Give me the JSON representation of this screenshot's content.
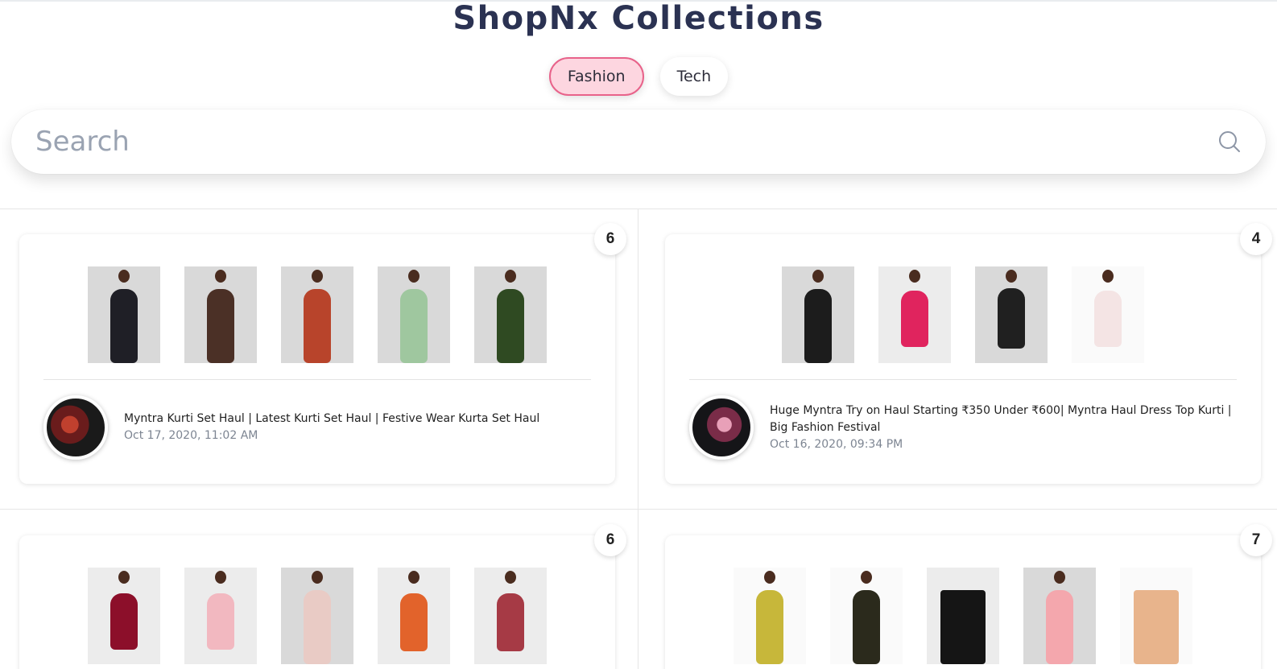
{
  "header": {
    "brand_a": "ShopNx",
    "brand_b": "Collections"
  },
  "tabs": [
    {
      "label": "Fashion",
      "active": true
    },
    {
      "label": "Tech",
      "active": false
    }
  ],
  "search": {
    "placeholder": "Search",
    "value": ""
  },
  "colors": {
    "accent": "#e8628a",
    "accent_bg": "#fdd6e0",
    "title": "#2b3252"
  },
  "collections": [
    {
      "count": "6",
      "title": "Myntra Kurti Set Haul | Latest Kurti Set Haul | Festive Wear Kurta Set Haul",
      "date": "Oct 17, 2020, 11:02 AM",
      "products": [
        "black kurta set",
        "brown kurta set",
        "rust kurta set",
        "mint kurta set",
        "olive kurta set"
      ]
    },
    {
      "count": "4",
      "title": "Huge Myntra Try on Haul Starting ₹350 Under ₹600| Myntra Haul Dress Top Kurti | Big Fashion Festival",
      "date": "Oct 16, 2020, 09:34 PM",
      "products": [
        "black floral maxi dress",
        "pink ruffle dress",
        "black floral dress",
        "white floral dress"
      ]
    },
    {
      "count": "6",
      "products": [
        "maroon dress",
        "pink lace dress",
        "floral wrap dress",
        "orange floral dress",
        "checked dress"
      ]
    },
    {
      "count": "7",
      "products": [
        "yellow kurta",
        "black printed kurta",
        "black palazzo",
        "pink kurta",
        "peach palazzo"
      ]
    }
  ]
}
